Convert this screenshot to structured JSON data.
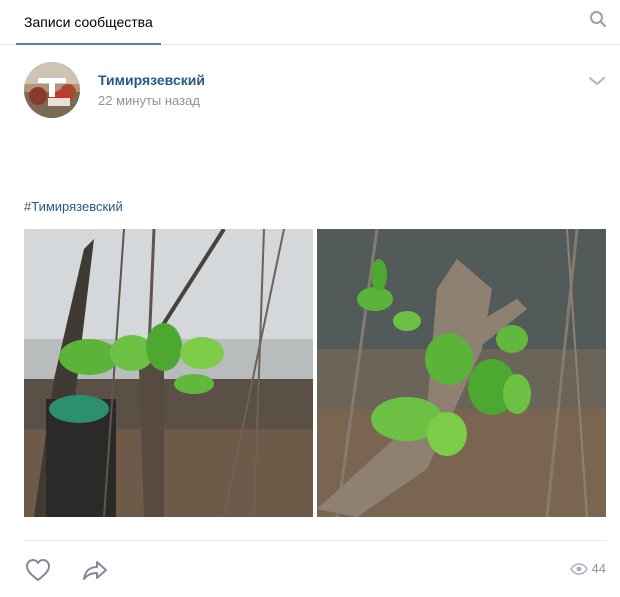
{
  "tabs": {
    "active_label": "Записи сообщества"
  },
  "post": {
    "author": "Тимирязевский",
    "time": "22 минуты назад",
    "hashtag": "#Тимирязевский",
    "views": "44"
  },
  "icons": {
    "search": "search-icon",
    "menu": "chevron-down-icon",
    "like": "heart-icon",
    "share": "share-arrow-icon",
    "views": "eye-icon"
  },
  "colors": {
    "link": "#2a5885",
    "accent": "#5181b8",
    "muted": "#939393",
    "divider": "#e7e8ec"
  }
}
